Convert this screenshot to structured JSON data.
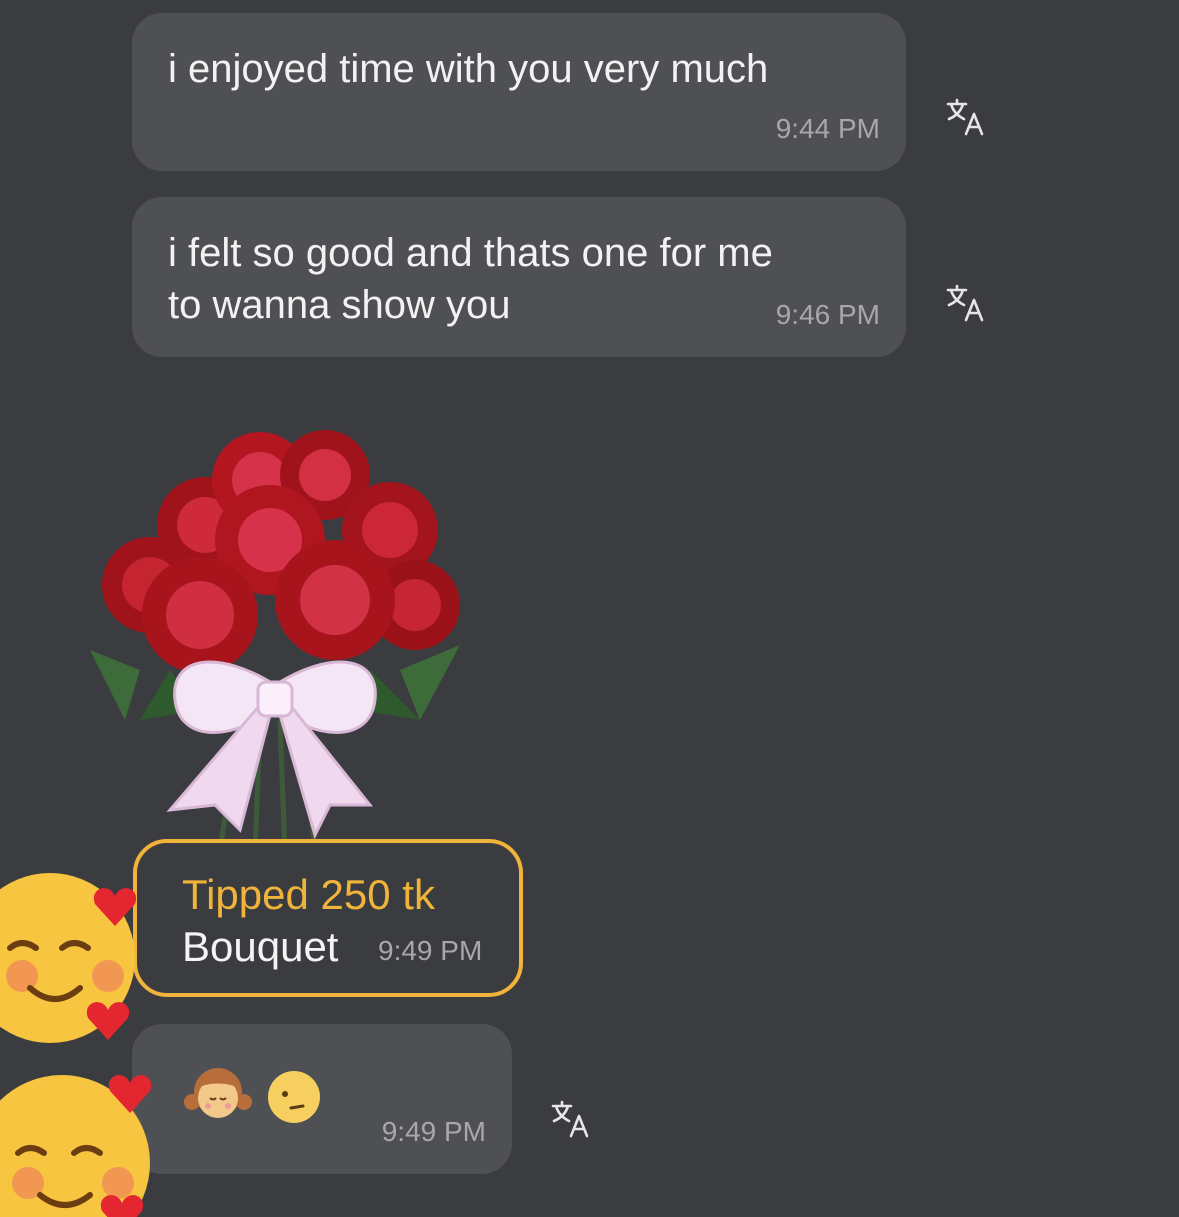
{
  "messages": [
    {
      "text": "i enjoyed time with you very much",
      "time": "9:44 PM"
    },
    {
      "text": "i felt so good and thats one for me\nto wanna show you",
      "time": "9:46 PM"
    }
  ],
  "gift": {
    "title": "Tipped 250 tk",
    "name": "Bouquet",
    "time": "9:49 PM",
    "accent": "#f1b43a",
    "image": "rose-bouquet"
  },
  "emoji_message": {
    "emojis": [
      "girl-emoji",
      "face-with-raised-eyebrow-emoji"
    ],
    "time": "9:49 PM"
  },
  "icons": {
    "translate": "translate-icon",
    "avatar": "smiling-face-with-hearts-emoji"
  },
  "colors": {
    "background": "#3b3c40",
    "bubble": "#4f5054",
    "timestamp": "#a8a8ab"
  }
}
